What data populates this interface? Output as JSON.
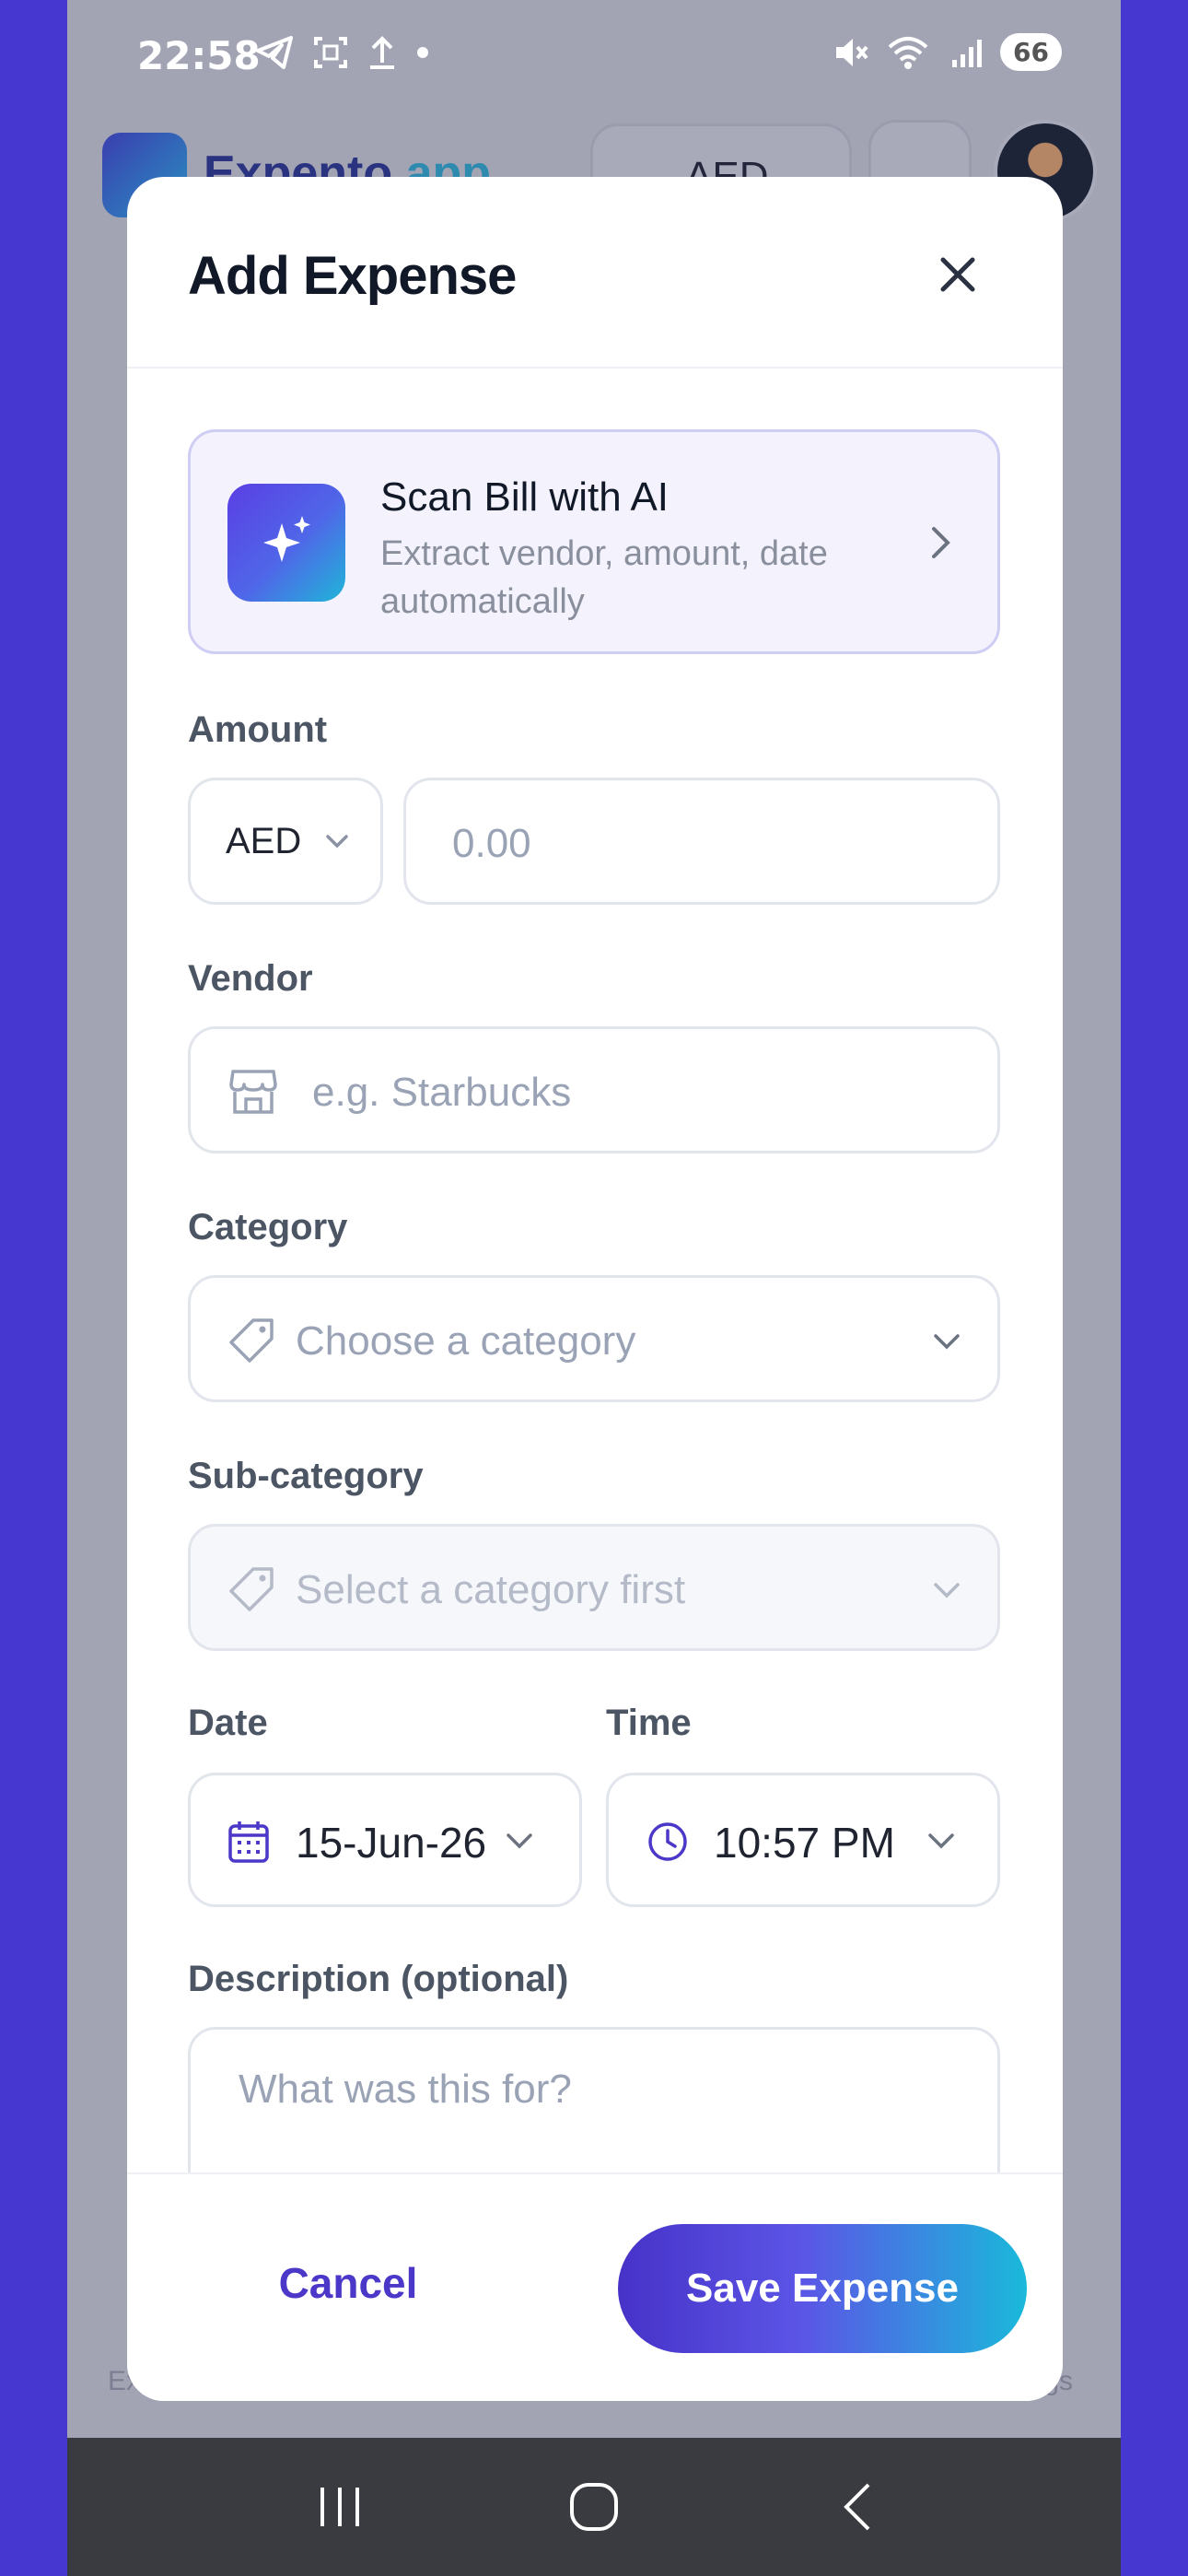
{
  "status_bar": {
    "time": "22:58",
    "battery": "66"
  },
  "app": {
    "title_main": "Expento",
    "title_accent": ".app",
    "currency": "AED"
  },
  "bg_bottom": {
    "left_label": "Ex",
    "right_label": "gs"
  },
  "modal": {
    "title": "Add Expense",
    "scan": {
      "title": "Scan Bill with AI",
      "subtitle": "Extract vendor, amount, date automatically"
    },
    "amount": {
      "label": "Amount",
      "currency": "AED",
      "placeholder": "0.00"
    },
    "vendor": {
      "label": "Vendor",
      "placeholder": "e.g. Starbucks"
    },
    "category": {
      "label": "Category",
      "placeholder": "Choose a category"
    },
    "subcategory": {
      "label": "Sub-category",
      "placeholder": "Select a category first"
    },
    "date": {
      "label": "Date",
      "value": "15-Jun-26"
    },
    "time": {
      "label": "Time",
      "value": "10:57 PM"
    },
    "description": {
      "label": "Description (optional)",
      "placeholder": "What was this for?"
    },
    "cancel_label": "Cancel",
    "save_label": "Save Expense"
  },
  "colors": {
    "accent": "#4b37c8",
    "gradient_end": "#1ab9da",
    "side": "#4537cf"
  },
  "icons": [
    "telegram-icon",
    "screenshot-icon",
    "upload-icon",
    "mute-icon",
    "wifi-icon",
    "signal-icon",
    "sparkle-icon",
    "store-icon",
    "tag-icon",
    "calendar-icon",
    "clock-icon",
    "close-icon",
    "chevron-down-icon",
    "chevron-right-icon"
  ]
}
